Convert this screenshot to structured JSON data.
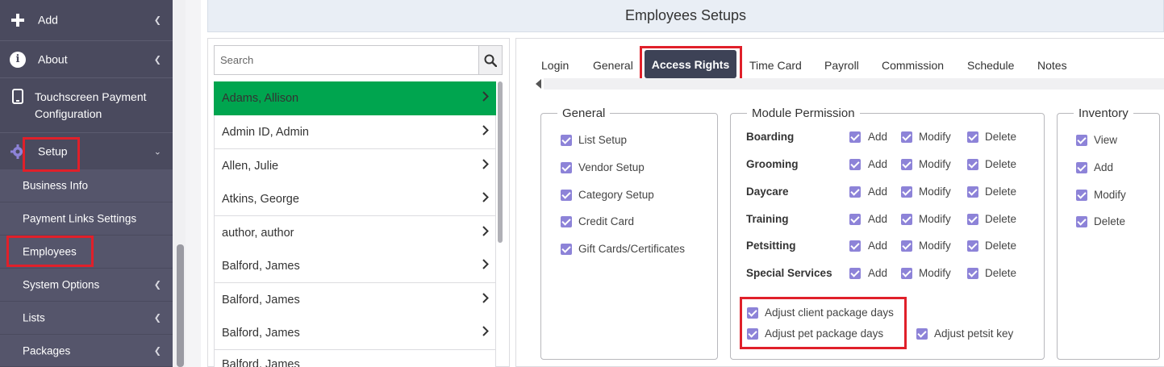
{
  "sidebar": {
    "main_items": [
      {
        "label": "Add",
        "icon": "plus-icon"
      },
      {
        "label": "About",
        "icon": "info-icon"
      },
      {
        "label": "Touchscreen Payment Configuration",
        "icon": "tablet-icon"
      },
      {
        "label": "Setup",
        "icon": "gear-icon"
      }
    ],
    "sub_items": [
      {
        "label": "Business Info"
      },
      {
        "label": "Payment Links Settings"
      },
      {
        "label": "Employees"
      },
      {
        "label": "System Options"
      },
      {
        "label": "Lists"
      },
      {
        "label": "Packages"
      }
    ]
  },
  "page": {
    "title": "Employees Setups"
  },
  "employee_list": {
    "search_placeholder": "Search",
    "rows": [
      "Adams, Allison",
      "Admin ID, Admin",
      "Allen, Julie",
      "Atkins, George",
      "author, author",
      "Balford, James",
      "Balford, James",
      "Balford, James",
      "Balford, James"
    ],
    "active_color": "#00a54f"
  },
  "tabs": [
    "Login",
    "General",
    "Access Rights",
    "Time Card",
    "Payroll",
    "Commission",
    "Schedule",
    "Notes"
  ],
  "active_tab": "Access Rights",
  "general": {
    "legend": "General",
    "items": [
      "List Setup",
      "Vendor Setup",
      "Category Setup",
      "Credit Card",
      "Gift Cards/Certificates"
    ]
  },
  "module_permission": {
    "legend": "Module Permission",
    "modules": [
      "Boarding",
      "Grooming",
      "Daycare",
      "Training",
      "Petsitting",
      "Special Services"
    ],
    "actions": [
      "Add",
      "Modify",
      "Delete"
    ],
    "extras": [
      "Adjust client package days",
      "Adjust pet package days",
      "Adjust petsit key"
    ]
  },
  "inventory": {
    "legend": "Inventory",
    "items": [
      "View",
      "Add",
      "Modify",
      "Delete"
    ]
  },
  "colors": {
    "sidebar_bg": "#4a4a5e",
    "checkbox": "#8d83d8",
    "highlight": "#e0202a",
    "active_tab_bg": "#3d4256"
  }
}
